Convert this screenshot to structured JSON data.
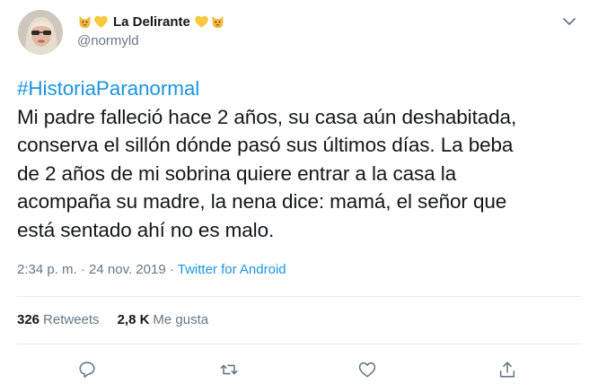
{
  "tweet": {
    "display_name": "La Delirante",
    "handle": "@normyld",
    "name_emojis": [
      "cat-face-icon",
      "yellow-heart-icon"
    ],
    "lines": [
      "#HistoriaParanormal",
      "Mi padre falleció hace 2 años, su casa aún deshabitada,",
      "conserva el sillón dónde pasó sus últimos días. La beba",
      "de 2 años de mi sobrina quiere entrar a la casa la",
      "acompaña su madre, la nena dice: mamá, el señor que",
      "está sentado ahí no es malo."
    ],
    "timestamp": "2:34 p. m. · 24 nov. 2019",
    "separator": " · ",
    "source": "Twitter for Android",
    "retweets_count": "326",
    "retweets_label": "Retweets",
    "likes_count": "2,8 K",
    "likes_label": "Me gusta"
  },
  "actions": [
    "reply-icon",
    "retweet-icon",
    "like-icon",
    "share-icon"
  ],
  "colors": {
    "text": "#14171a",
    "secondary": "#657786",
    "link": "#1b95e0",
    "divider": "#e6ecf0"
  }
}
